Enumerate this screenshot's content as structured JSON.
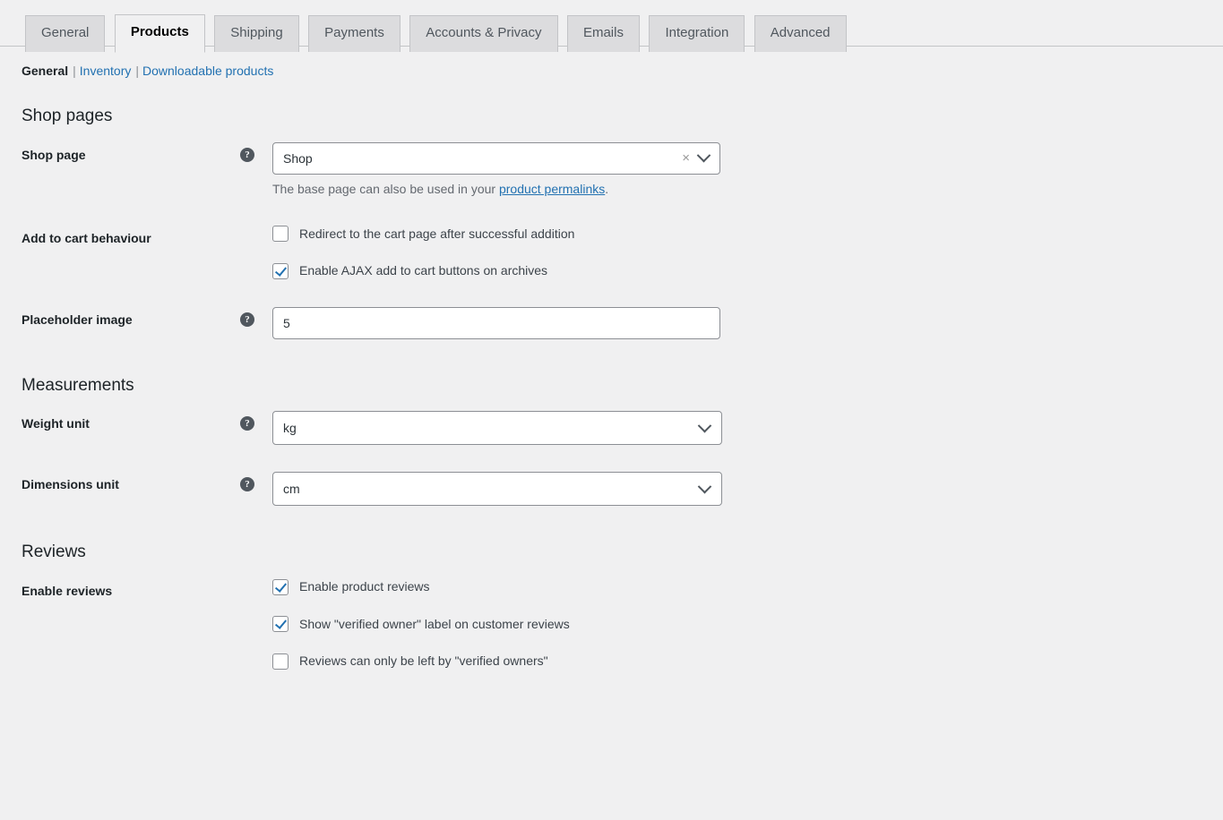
{
  "tabs": [
    {
      "label": "General",
      "active": false
    },
    {
      "label": "Products",
      "active": true
    },
    {
      "label": "Shipping",
      "active": false
    },
    {
      "label": "Payments",
      "active": false
    },
    {
      "label": "Accounts & Privacy",
      "active": false
    },
    {
      "label": "Emails",
      "active": false
    },
    {
      "label": "Integration",
      "active": false
    },
    {
      "label": "Advanced",
      "active": false
    }
  ],
  "subnav": {
    "items": [
      {
        "label": "General",
        "current": true
      },
      {
        "label": "Inventory",
        "current": false
      },
      {
        "label": "Downloadable products",
        "current": false
      }
    ],
    "separator": "|"
  },
  "sections": {
    "shop_pages": {
      "heading": "Shop pages",
      "shop_page": {
        "label": "Shop page",
        "help_glyph": "?",
        "value": "Shop",
        "clear_glyph": "×",
        "description_before": "The base page can also be used in your ",
        "description_link": "product permalinks",
        "description_after": "."
      },
      "add_to_cart": {
        "label": "Add to cart behaviour",
        "options": [
          {
            "label": "Redirect to the cart page after successful addition",
            "checked": false
          },
          {
            "label": "Enable AJAX add to cart buttons on archives",
            "checked": true
          }
        ]
      },
      "placeholder_image": {
        "label": "Placeholder image",
        "help_glyph": "?",
        "value": "5"
      }
    },
    "measurements": {
      "heading": "Measurements",
      "weight_unit": {
        "label": "Weight unit",
        "help_glyph": "?",
        "value": "kg"
      },
      "dimensions_unit": {
        "label": "Dimensions unit",
        "help_glyph": "?",
        "value": "cm"
      }
    },
    "reviews": {
      "heading": "Reviews",
      "enable_reviews": {
        "label": "Enable reviews",
        "options": [
          {
            "label": "Enable product reviews",
            "checked": true
          },
          {
            "label": "Show \"verified owner\" label on customer reviews",
            "checked": true
          },
          {
            "label": "Reviews can only be left by \"verified owners\"",
            "checked": false
          }
        ]
      }
    }
  },
  "colors": {
    "page_background": "#f0f0f1",
    "tab_inactive": "#dcdcde",
    "border": "#c3c4c7",
    "link": "#2271b1",
    "accent_check": "#2271b1",
    "label_text": "#1d2327",
    "muted_text": "#646970"
  }
}
